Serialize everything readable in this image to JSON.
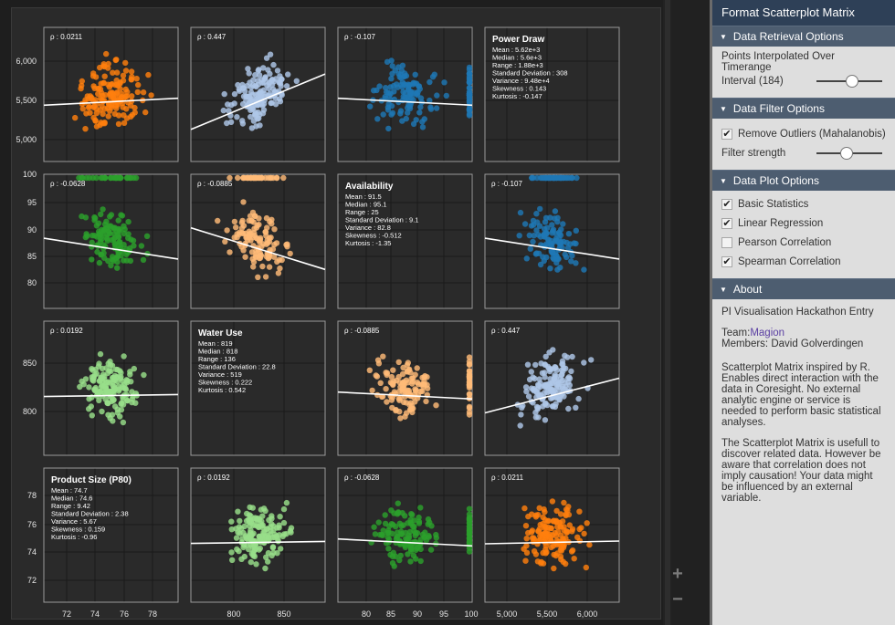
{
  "panel": {
    "title": "Format Scatterplot Matrix",
    "sections": {
      "retrieval": {
        "header": "Data Retrieval Options",
        "text": "Points Interpolated Over Timerange",
        "slider_label": "Interval (184)",
        "slider_value": 0.55
      },
      "filter": {
        "header": "Data Filter Options",
        "checkbox_label": "Remove Outliers (Mahalanobis)",
        "checked": true,
        "slider_label": "Filter strength",
        "slider_value": 0.45
      },
      "plot": {
        "header": "Data Plot Options",
        "options": [
          {
            "label": "Basic Statistics",
            "checked": true
          },
          {
            "label": "Linear Regression",
            "checked": true
          },
          {
            "label": "Pearson Correlation",
            "checked": false
          },
          {
            "label": "Spearman Correlation",
            "checked": true
          }
        ]
      },
      "about": {
        "header": "About",
        "line1": "PI Visualisation Hackathon Entry",
        "team_prefix": "Team:",
        "team_link": "Magion",
        "members": "Members: David Golverdingen",
        "para1": "Scatterplot Matrix inspired by R. Enables direct interaction with the data in Coresight. No external analytic engine or service is needed to perform basic statistical analyses.",
        "para2": "The Scatterplot Matrix is usefull to discover related data. However be aware that correlation does not imply causation! Your data might be influenced by an external variable."
      }
    }
  },
  "zoom": {
    "plus": "+",
    "minus": "−"
  },
  "icons": {
    "section_toggle": "triangle-down-icon",
    "check": "check-icon"
  },
  "colors": {
    "Power Draw": "#1f77b4",
    "Availability": "#2ca02c",
    "Water Use": "#98df8a",
    "Product Size (P80)": "#ff7f0e",
    "orange_light": "#ffbb78",
    "blue_light": "#aec7e8"
  },
  "chart_data": {
    "type": "scatter",
    "variables": [
      "Power Draw",
      "Availability",
      "Water Use",
      "Product Size (P80)"
    ],
    "axis_ticks": {
      "Power Draw": [
        "5,000",
        "5,500",
        "6,000"
      ],
      "Availability": [
        "80",
        "85",
        "90",
        "95",
        "100"
      ],
      "Water Use": [
        "800",
        "850"
      ],
      "Product Size (P80)": [
        "72",
        "74",
        "76",
        "78"
      ]
    },
    "stats": {
      "Power Draw": [
        "Mean : 5.62e+3",
        "Median : 5.6e+3",
        "Range : 1.88e+3",
        "Standard Deviation : 308",
        "Variance : 9.48e+4",
        "Skewness : 0.143",
        "Kurtosis : -0.147"
      ],
      "Availability": [
        "Mean : 91.5",
        "Median : 95.1",
        "Range : 25",
        "Standard Deviation : 9.1",
        "Variance : 82.8",
        "Skewness : -0.512",
        "Kurtosis : -1.35"
      ],
      "Water Use": [
        "Mean : 819",
        "Median : 818",
        "Range : 136",
        "Standard Deviation : 22.8",
        "Variance : 519",
        "Skewness : 0.222",
        "Kurtosis : 0.542"
      ],
      "Product Size (P80)": [
        "Mean : 74.7",
        "Median : 74.6",
        "Range : 9.42",
        "Standard Deviation : 2.38",
        "Variance : 5.67",
        "Skewness : 0.159",
        "Kurtosis : -0.96"
      ]
    },
    "correlations": [
      {
        "row": "Power Draw",
        "col": "Product Size (P80)",
        "label": "ρ : 0.0211",
        "slope": 0.1
      },
      {
        "row": "Power Draw",
        "col": "Water Use",
        "label": "ρ : 0.447",
        "slope": 0.8
      },
      {
        "row": "Power Draw",
        "col": "Availability",
        "label": "ρ : -0.107",
        "slope": -0.1
      },
      {
        "row": "Availability",
        "col": "Product Size (P80)",
        "label": "ρ : -0.0628",
        "slope": -0.3
      },
      {
        "row": "Availability",
        "col": "Water Use",
        "label": "ρ : -0.0885",
        "slope": -0.6
      },
      {
        "row": "Availability",
        "col": "Power Draw",
        "label": "ρ : -0.107",
        "slope": -0.3
      },
      {
        "row": "Water Use",
        "col": "Product Size (P80)",
        "label": "ρ : 0.0192",
        "slope": 0.03
      },
      {
        "row": "Water Use",
        "col": "Availability",
        "label": "ρ : -0.0885",
        "slope": -0.1
      },
      {
        "row": "Water Use",
        "col": "Power Draw",
        "label": "ρ : 0.447",
        "slope": 0.5
      },
      {
        "row": "Product Size (P80)",
        "col": "Water Use",
        "label": "ρ : 0.0192",
        "slope": 0.03
      },
      {
        "row": "Product Size (P80)",
        "col": "Availability",
        "label": "ρ : -0.0628",
        "slope": -0.1
      },
      {
        "row": "Product Size (P80)",
        "col": "Power Draw",
        "label": "ρ : 0.0211",
        "slope": 0.04
      }
    ]
  }
}
